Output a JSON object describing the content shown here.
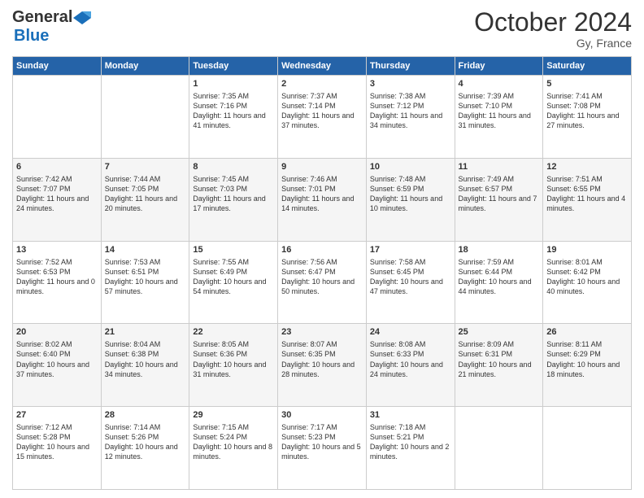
{
  "header": {
    "logo_line1": "General",
    "logo_line2": "Blue",
    "month_title": "October 2024",
    "location": "Gy, France"
  },
  "calendar": {
    "days_of_week": [
      "Sunday",
      "Monday",
      "Tuesday",
      "Wednesday",
      "Thursday",
      "Friday",
      "Saturday"
    ],
    "weeks": [
      [
        {
          "day": "",
          "info": ""
        },
        {
          "day": "",
          "info": ""
        },
        {
          "day": "1",
          "info": "Sunrise: 7:35 AM\nSunset: 7:16 PM\nDaylight: 11 hours and 41 minutes."
        },
        {
          "day": "2",
          "info": "Sunrise: 7:37 AM\nSunset: 7:14 PM\nDaylight: 11 hours and 37 minutes."
        },
        {
          "day": "3",
          "info": "Sunrise: 7:38 AM\nSunset: 7:12 PM\nDaylight: 11 hours and 34 minutes."
        },
        {
          "day": "4",
          "info": "Sunrise: 7:39 AM\nSunset: 7:10 PM\nDaylight: 11 hours and 31 minutes."
        },
        {
          "day": "5",
          "info": "Sunrise: 7:41 AM\nSunset: 7:08 PM\nDaylight: 11 hours and 27 minutes."
        }
      ],
      [
        {
          "day": "6",
          "info": "Sunrise: 7:42 AM\nSunset: 7:07 PM\nDaylight: 11 hours and 24 minutes."
        },
        {
          "day": "7",
          "info": "Sunrise: 7:44 AM\nSunset: 7:05 PM\nDaylight: 11 hours and 20 minutes."
        },
        {
          "day": "8",
          "info": "Sunrise: 7:45 AM\nSunset: 7:03 PM\nDaylight: 11 hours and 17 minutes."
        },
        {
          "day": "9",
          "info": "Sunrise: 7:46 AM\nSunset: 7:01 PM\nDaylight: 11 hours and 14 minutes."
        },
        {
          "day": "10",
          "info": "Sunrise: 7:48 AM\nSunset: 6:59 PM\nDaylight: 11 hours and 10 minutes."
        },
        {
          "day": "11",
          "info": "Sunrise: 7:49 AM\nSunset: 6:57 PM\nDaylight: 11 hours and 7 minutes."
        },
        {
          "day": "12",
          "info": "Sunrise: 7:51 AM\nSunset: 6:55 PM\nDaylight: 11 hours and 4 minutes."
        }
      ],
      [
        {
          "day": "13",
          "info": "Sunrise: 7:52 AM\nSunset: 6:53 PM\nDaylight: 11 hours and 0 minutes."
        },
        {
          "day": "14",
          "info": "Sunrise: 7:53 AM\nSunset: 6:51 PM\nDaylight: 10 hours and 57 minutes."
        },
        {
          "day": "15",
          "info": "Sunrise: 7:55 AM\nSunset: 6:49 PM\nDaylight: 10 hours and 54 minutes."
        },
        {
          "day": "16",
          "info": "Sunrise: 7:56 AM\nSunset: 6:47 PM\nDaylight: 10 hours and 50 minutes."
        },
        {
          "day": "17",
          "info": "Sunrise: 7:58 AM\nSunset: 6:45 PM\nDaylight: 10 hours and 47 minutes."
        },
        {
          "day": "18",
          "info": "Sunrise: 7:59 AM\nSunset: 6:44 PM\nDaylight: 10 hours and 44 minutes."
        },
        {
          "day": "19",
          "info": "Sunrise: 8:01 AM\nSunset: 6:42 PM\nDaylight: 10 hours and 40 minutes."
        }
      ],
      [
        {
          "day": "20",
          "info": "Sunrise: 8:02 AM\nSunset: 6:40 PM\nDaylight: 10 hours and 37 minutes."
        },
        {
          "day": "21",
          "info": "Sunrise: 8:04 AM\nSunset: 6:38 PM\nDaylight: 10 hours and 34 minutes."
        },
        {
          "day": "22",
          "info": "Sunrise: 8:05 AM\nSunset: 6:36 PM\nDaylight: 10 hours and 31 minutes."
        },
        {
          "day": "23",
          "info": "Sunrise: 8:07 AM\nSunset: 6:35 PM\nDaylight: 10 hours and 28 minutes."
        },
        {
          "day": "24",
          "info": "Sunrise: 8:08 AM\nSunset: 6:33 PM\nDaylight: 10 hours and 24 minutes."
        },
        {
          "day": "25",
          "info": "Sunrise: 8:09 AM\nSunset: 6:31 PM\nDaylight: 10 hours and 21 minutes."
        },
        {
          "day": "26",
          "info": "Sunrise: 8:11 AM\nSunset: 6:29 PM\nDaylight: 10 hours and 18 minutes."
        }
      ],
      [
        {
          "day": "27",
          "info": "Sunrise: 7:12 AM\nSunset: 5:28 PM\nDaylight: 10 hours and 15 minutes."
        },
        {
          "day": "28",
          "info": "Sunrise: 7:14 AM\nSunset: 5:26 PM\nDaylight: 10 hours and 12 minutes."
        },
        {
          "day": "29",
          "info": "Sunrise: 7:15 AM\nSunset: 5:24 PM\nDaylight: 10 hours and 8 minutes."
        },
        {
          "day": "30",
          "info": "Sunrise: 7:17 AM\nSunset: 5:23 PM\nDaylight: 10 hours and 5 minutes."
        },
        {
          "day": "31",
          "info": "Sunrise: 7:18 AM\nSunset: 5:21 PM\nDaylight: 10 hours and 2 minutes."
        },
        {
          "day": "",
          "info": ""
        },
        {
          "day": "",
          "info": ""
        }
      ]
    ]
  }
}
